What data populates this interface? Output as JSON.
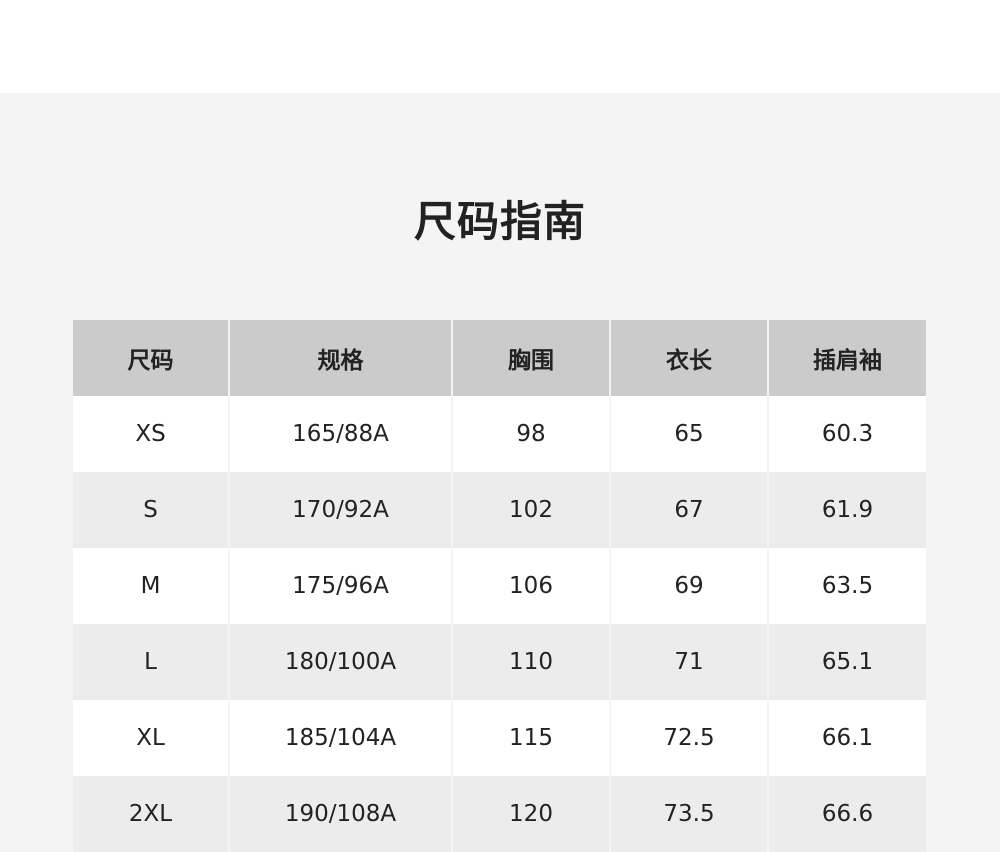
{
  "page": {
    "title": "尺码指南"
  },
  "size_table": {
    "headers": [
      "尺码",
      "规格",
      "胸围",
      "衣长",
      "插肩袖"
    ],
    "rows": [
      [
        "XS",
        "165/88A",
        "98",
        "65",
        "60.3"
      ],
      [
        "S",
        "170/92A",
        "102",
        "67",
        "61.9"
      ],
      [
        "M",
        "175/96A",
        "106",
        "69",
        "63.5"
      ],
      [
        "L",
        "180/100A",
        "110",
        "71",
        "65.1"
      ],
      [
        "XL",
        "185/104A",
        "115",
        "72.5",
        "66.1"
      ],
      [
        "2XL",
        "190/108A",
        "120",
        "73.5",
        "66.6"
      ]
    ]
  },
  "colors": {
    "page_bg": "#f4f4f4",
    "header_bg": "#cbcbcb",
    "row_alt_bg": "#ececec",
    "row_bg": "#ffffff",
    "text": "#222222"
  }
}
